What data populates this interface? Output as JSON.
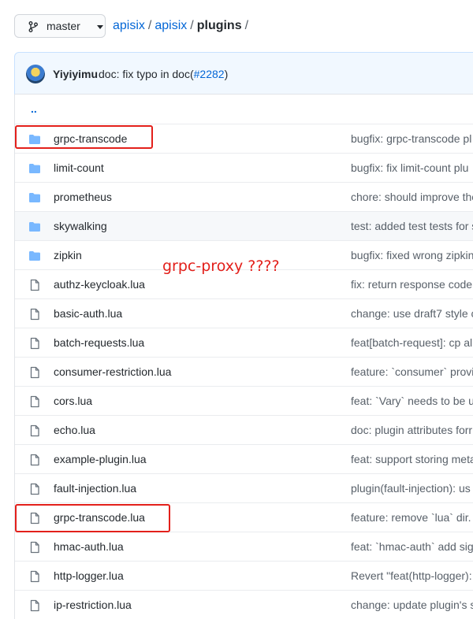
{
  "branch": {
    "label": "master"
  },
  "breadcrumb": {
    "owner": "apisix",
    "repo": "apisix",
    "current": "plugins",
    "sep": "/"
  },
  "last_commit": {
    "author": "Yiyiyimu",
    "message": "doc: fix typo in doc(",
    "link": "#2282",
    "suffix": ")"
  },
  "parent": {
    "label": ".."
  },
  "files": [
    {
      "name": "grpc-transcode",
      "type": "folder",
      "commit": "bugfix: grpc-transcode pl"
    },
    {
      "name": "limit-count",
      "type": "folder",
      "commit": "bugfix: fix limit-count plu"
    },
    {
      "name": "prometheus",
      "type": "folder",
      "commit": "chore: should improve the"
    },
    {
      "name": "skywalking",
      "type": "folder",
      "commit": "test: added test tests for s"
    },
    {
      "name": "zipkin",
      "type": "folder",
      "commit": "bugfix: fixed wrong zipkin"
    },
    {
      "name": "authz-keycloak.lua",
      "type": "file",
      "commit": "fix: return response code"
    },
    {
      "name": "basic-auth.lua",
      "type": "file",
      "commit": "change: use draft7 style c"
    },
    {
      "name": "batch-requests.lua",
      "type": "file",
      "commit": "feat[batch-request]: cp all"
    },
    {
      "name": "consumer-restriction.lua",
      "type": "file",
      "commit": "feature: `consumer` provi"
    },
    {
      "name": "cors.lua",
      "type": "file",
      "commit": "feat: `Vary` needs to be us"
    },
    {
      "name": "echo.lua",
      "type": "file",
      "commit": "doc: plugin attributes forr"
    },
    {
      "name": "example-plugin.lua",
      "type": "file",
      "commit": "feat: support storing meta"
    },
    {
      "name": "fault-injection.lua",
      "type": "file",
      "commit": "plugin(fault-injection): us"
    },
    {
      "name": "grpc-transcode.lua",
      "type": "file",
      "commit": "feature: remove `lua` dir. c"
    },
    {
      "name": "hmac-auth.lua",
      "type": "file",
      "commit": "feat: `hmac-auth` add sign"
    },
    {
      "name": "http-logger.lua",
      "type": "file",
      "commit": "Revert \"feat(http-logger):"
    },
    {
      "name": "ip-restriction.lua",
      "type": "file",
      "commit": "change: update plugin's s"
    }
  ],
  "annotation": {
    "text": "grpc-proxy ????"
  },
  "colors": {
    "link": "#0366d6",
    "folder": "#79b8ff",
    "annotation": "#e3201b",
    "commit_bg": "#f1f8ff"
  }
}
